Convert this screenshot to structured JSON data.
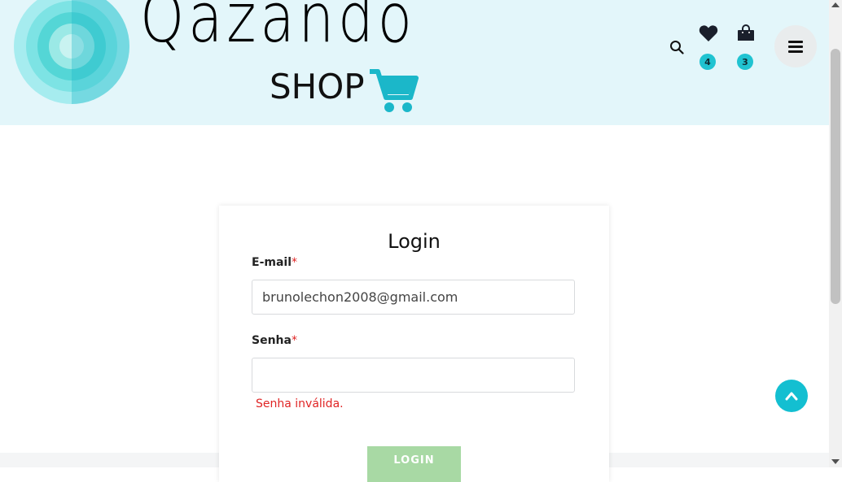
{
  "header": {
    "logo_word": "Qazando",
    "logo_shop": "SHOP",
    "wishlist_count": "4",
    "cart_count": "3"
  },
  "icons": {
    "search": "search-icon",
    "wishlist": "heart-icon",
    "cart": "shopping-bag-icon",
    "menu": "hamburger-menu-icon",
    "back_to_top": "chevron-up-icon"
  },
  "login": {
    "title": "Login",
    "email_label": "E-mail",
    "email_required": "*",
    "email_value": "brunolechon2008@gmail.com",
    "password_label": "Senha",
    "password_required": "*",
    "password_value": "",
    "error_message": "Senha inválida.",
    "submit_label": "LOGIN"
  },
  "colors": {
    "header_bg": "#e3f6fa",
    "accent": "#20c3d1",
    "error": "#e02424",
    "button_bg": "#a8d9a4"
  }
}
